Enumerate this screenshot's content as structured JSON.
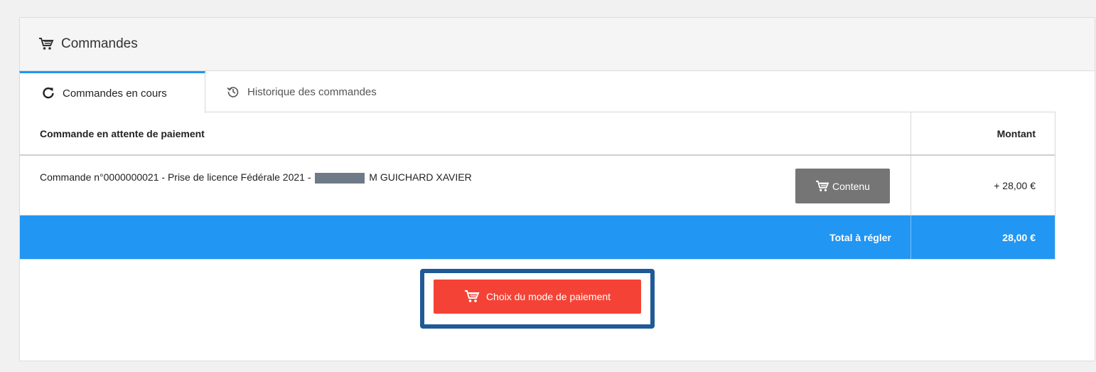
{
  "panel": {
    "title": "Commandes",
    "icon": "cart-icon"
  },
  "tabs": [
    {
      "label": "Commandes en cours",
      "icon": "refresh-icon",
      "active": true
    },
    {
      "label": "Historique des commandes",
      "icon": "history-icon",
      "active": false
    }
  ],
  "table": {
    "headers": {
      "left": "Commande en attente de paiement",
      "right": "Montant"
    },
    "rows": [
      {
        "desc_before": "Commande n°0000000021 - Prise de licence Fédérale 2021 -",
        "desc_after": "M GUICHARD XAVIER",
        "button_label": "Contenu",
        "amount": "+ 28,00 €"
      }
    ],
    "total": {
      "label": "Total à régler",
      "amount": "28,00 €"
    }
  },
  "pay_button": {
    "label": "Choix du mode de paiement"
  },
  "colors": {
    "accent": "#2196f3",
    "pay_button": "#f44336",
    "secondary_button": "#757575",
    "highlight": "#1f5a96"
  }
}
